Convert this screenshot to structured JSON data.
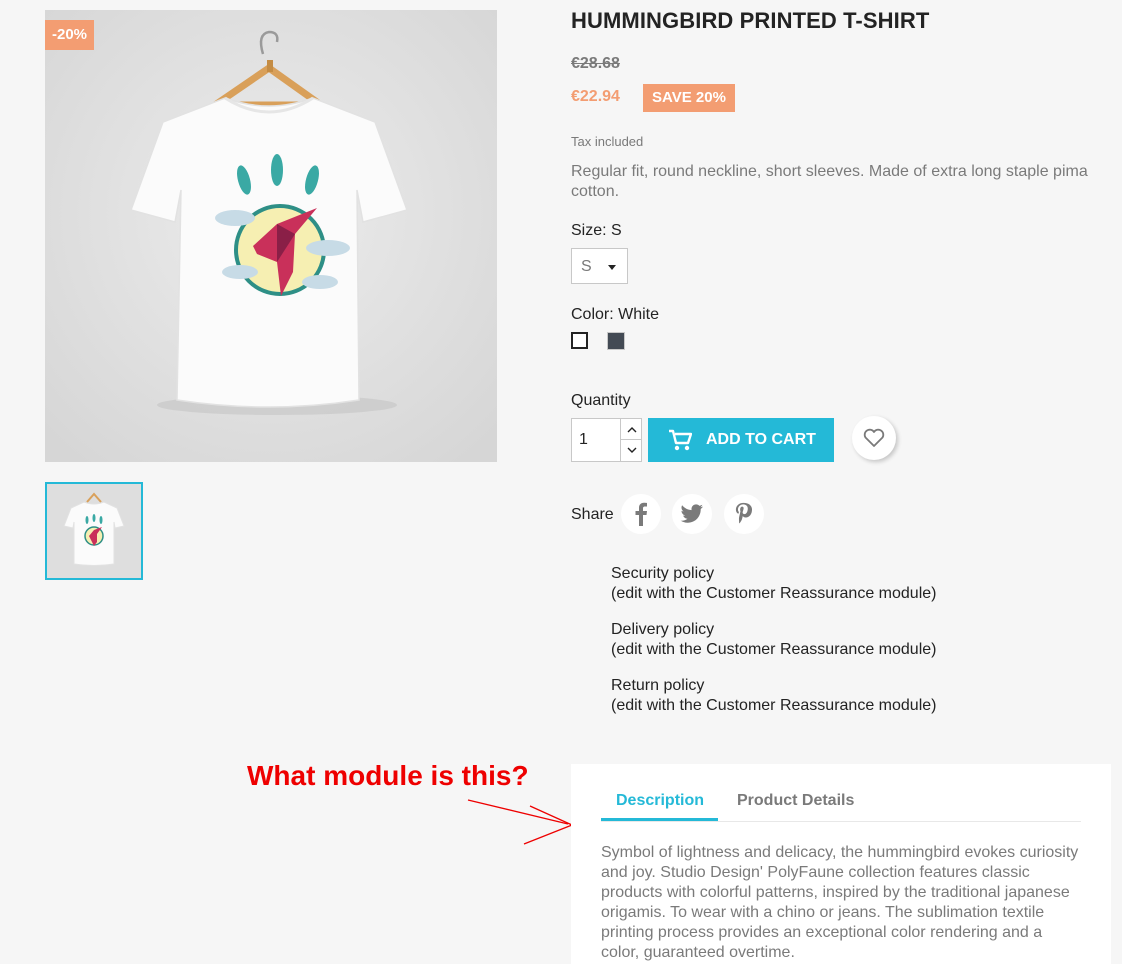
{
  "product": {
    "title": "HUMMINGBIRD PRINTED T-SHIRT",
    "discount_flag": "-20%",
    "old_price": "€28.68",
    "price": "€22.94",
    "save_badge": "SAVE 20%",
    "tax_note": "Tax included",
    "short_description": "Regular fit, round neckline, short sleeves. Made of extra long staple pima cotton."
  },
  "variants": {
    "size_label": "Size: S",
    "size_value": "S",
    "color_label": "Color: White",
    "colors": [
      {
        "name": "White",
        "hex": "#ffffff",
        "selected": true
      },
      {
        "name": "Black",
        "hex": "#434a54",
        "selected": false
      }
    ]
  },
  "purchase": {
    "quantity_label": "Quantity",
    "quantity_value": "1",
    "add_to_cart_label": "ADD TO CART"
  },
  "share": {
    "label": "Share",
    "networks": [
      "facebook-icon",
      "twitter-icon",
      "pinterest-icon"
    ]
  },
  "reassurance": [
    {
      "title": "Security policy",
      "note": "(edit with the Customer Reassurance module)"
    },
    {
      "title": "Delivery policy",
      "note": "(edit with the Customer Reassurance module)"
    },
    {
      "title": "Return policy",
      "note": "(edit with the Customer Reassurance module)"
    }
  ],
  "annotation": {
    "text": "What module is this?",
    "color": "#ee0000"
  },
  "tabs": {
    "items": [
      {
        "label": "Description",
        "active": true
      },
      {
        "label": "Product Details",
        "active": false
      }
    ],
    "description": "Symbol of lightness and delicacy, the hummingbird evokes curiosity and joy. Studio Design' PolyFaune collection features classic products with colorful patterns, inspired by the traditional japanese origamis. To wear with a chino or jeans. The sublimation textile printing process provides an exceptional color rendering and a color, guaranteed overtime."
  },
  "colors": {
    "accent": "#24b9d7",
    "discount": "#f39d72",
    "text": "#232323",
    "muted": "#7a7a7a",
    "background": "#f6f6f6"
  }
}
